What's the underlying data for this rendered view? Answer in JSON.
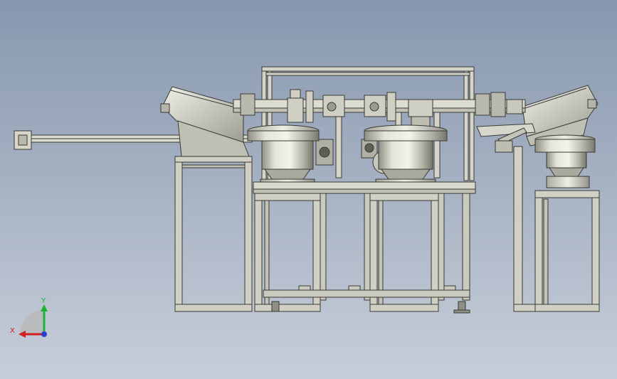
{
  "viewport": {
    "background_top": "#8797ae",
    "background_bottom": "#c7ced9"
  },
  "triad": {
    "x_label": "X",
    "y_label": "Y",
    "x_color": "#d11f1f",
    "y_color": "#19b43a",
    "z_color": "#2a3fd6"
  },
  "model": {
    "frame_color": "#cfcfc2",
    "edge_color": "#3a3a36",
    "bowl_color": "#d7d7cc"
  }
}
